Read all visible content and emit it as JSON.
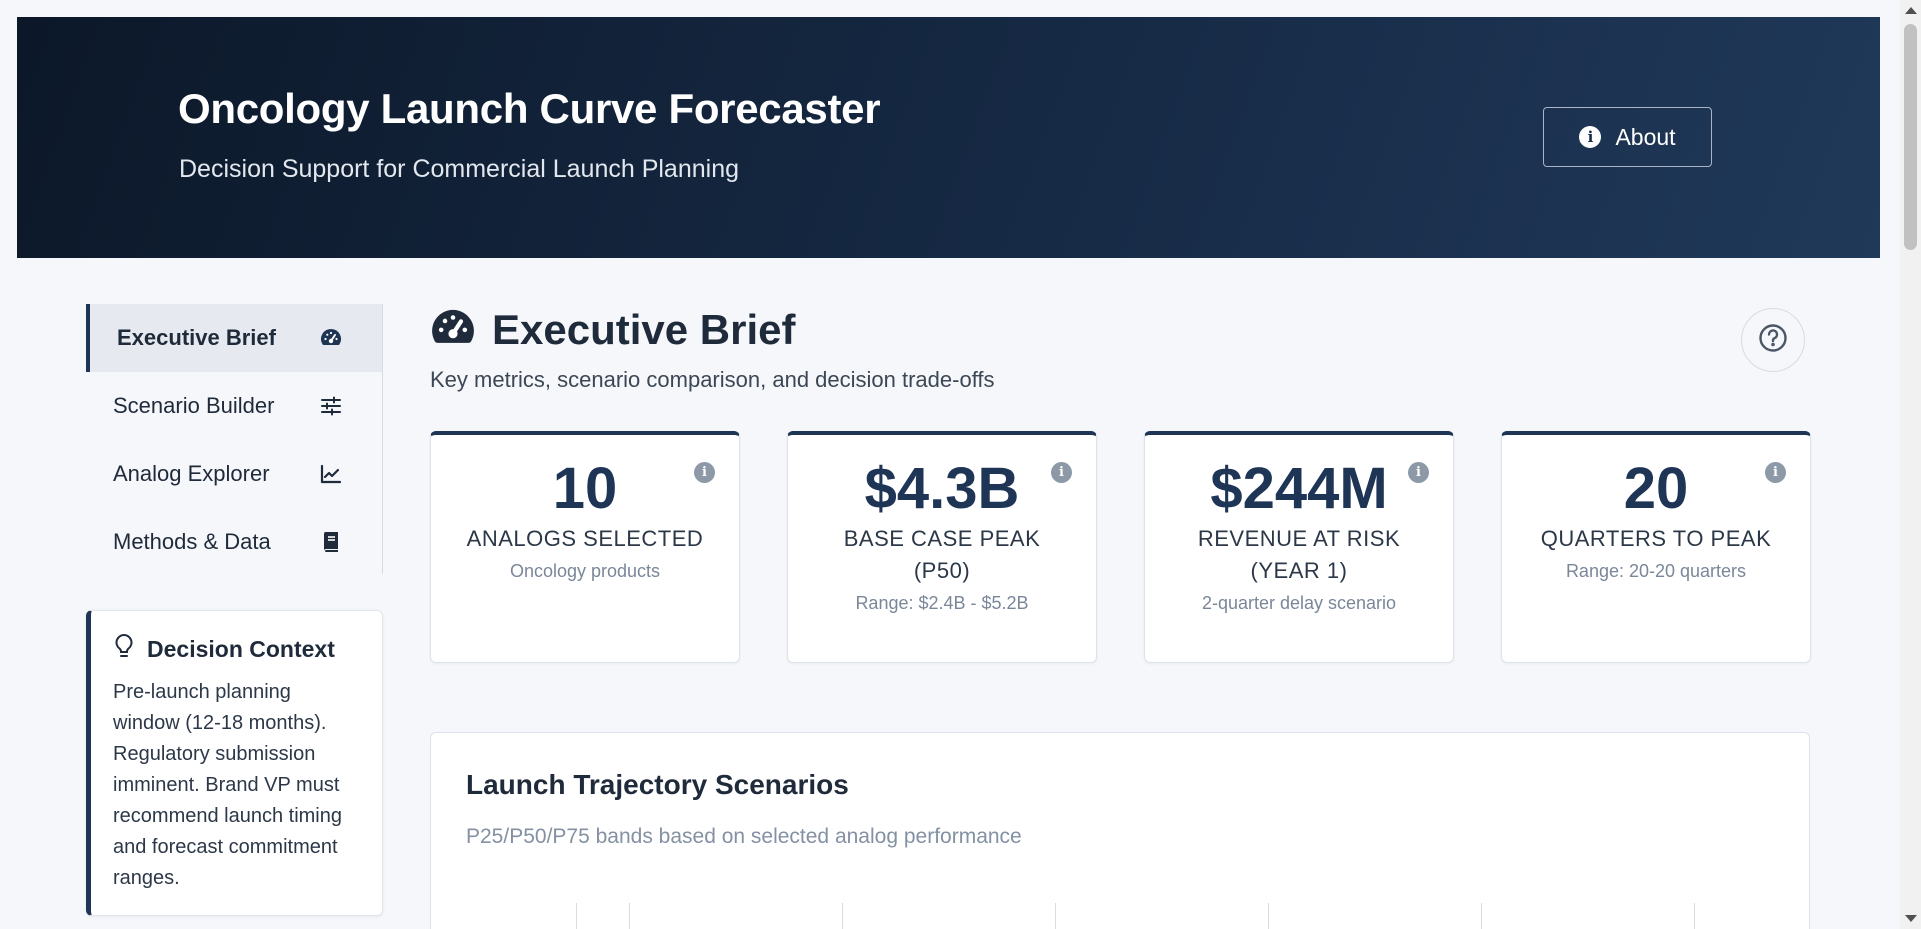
{
  "header": {
    "title": "Oncology Launch Curve Forecaster",
    "subtitle": "Decision Support for Commercial Launch Planning",
    "about_label": "About"
  },
  "nav": {
    "items": [
      {
        "label": "Executive Brief",
        "icon": "gauge-icon",
        "active": true
      },
      {
        "label": "Scenario Builder",
        "icon": "sliders-icon",
        "active": false
      },
      {
        "label": "Analog Explorer",
        "icon": "line-chart-icon",
        "active": false
      },
      {
        "label": "Methods & Data",
        "icon": "book-icon",
        "active": false
      }
    ]
  },
  "context": {
    "title": "Decision Context",
    "body": "Pre-launch planning window (12-18 months). Regulatory submission imminent. Brand VP must recommend launch timing and forecast commitment ranges."
  },
  "main": {
    "title": "Executive Brief",
    "subtitle": "Key metrics, scenario comparison, and decision trade-offs"
  },
  "kpis": [
    {
      "value": "10",
      "label": "ANALOGS SELECTED",
      "note": "Oncology products"
    },
    {
      "value": "$4.3B",
      "label": "BASE CASE PEAK (P50)",
      "note": "Range: $2.4B - $5.2B"
    },
    {
      "value": "$244M",
      "label": "REVENUE AT RISK (YEAR 1)",
      "note": "2-quarter delay scenario"
    },
    {
      "value": "20",
      "label": "QUARTERS TO PEAK",
      "note": "Range: 20-20 quarters"
    }
  ],
  "chart": {
    "title": "Launch Trajectory Scenarios",
    "subtitle": "P25/P50/P75 bands based on selected analog performance"
  },
  "colors": {
    "header_dark": "#0c1829",
    "accent": "#1e3556",
    "background": "#f5f7fa"
  }
}
